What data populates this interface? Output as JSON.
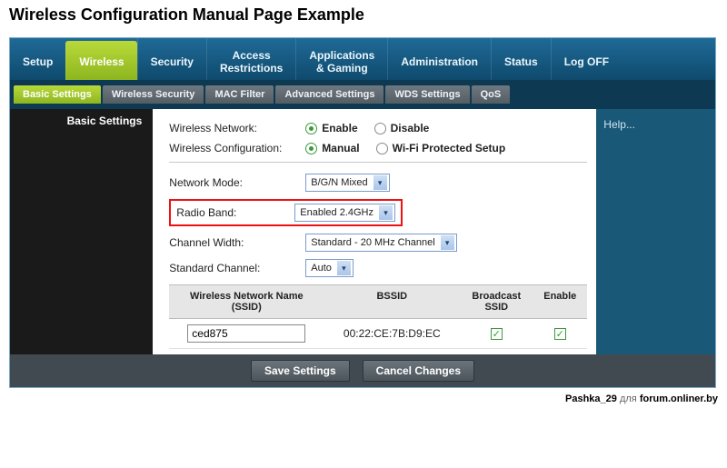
{
  "page_title": "Wireless Configuration Manual Page Example",
  "top_nav": {
    "setup": "Setup",
    "wireless": "Wireless",
    "security": "Security",
    "access": "Access\nRestrictions",
    "apps": "Applications\n& Gaming",
    "admin": "Administration",
    "status": "Status",
    "logoff": "Log OFF"
  },
  "sub_nav": {
    "basic": "Basic Settings",
    "wsec": "Wireless Security",
    "mac": "MAC Filter",
    "adv": "Advanced Settings",
    "wds": "WDS Settings",
    "qos": "QoS"
  },
  "left_title": "Basic Settings",
  "help_label": "Help...",
  "labels": {
    "wireless_network": "Wireless Network:",
    "wireless_config": "Wireless Configuration:",
    "network_mode": "Network Mode:",
    "radio_band": "Radio Band:",
    "channel_width": "Channel Width:",
    "standard_channel": "Standard Channel:"
  },
  "radios": {
    "enable": "Enable",
    "disable": "Disable",
    "manual": "Manual",
    "wps": "Wi-Fi Protected Setup"
  },
  "selects": {
    "network_mode": "B/G/N Mixed",
    "radio_band": "Enabled 2.4GHz",
    "channel_width": "Standard - 20 MHz Channel",
    "standard_channel": "Auto"
  },
  "table": {
    "headers": {
      "ssid": "Wireless Network Name (SSID)",
      "bssid": "BSSID",
      "broadcast": "Broadcast SSID",
      "enable": "Enable"
    },
    "row": {
      "ssid": "ced875",
      "bssid": "00:22:CE:7B:D9:EC"
    }
  },
  "buttons": {
    "save": "Save Settings",
    "cancel": "Cancel Changes"
  },
  "watermark": {
    "user": "Pashka_29",
    "mid": " для ",
    "site": "forum.onliner.by"
  }
}
